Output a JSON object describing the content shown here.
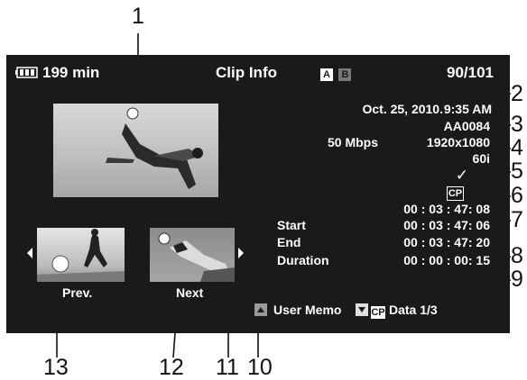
{
  "header": {
    "battery_time": "199 min",
    "title": "Clip Info",
    "slot_a": "A",
    "slot_b": "B",
    "clip_counter": "90/101"
  },
  "info": {
    "date": "Oct. 25, 2010.",
    "time": "9:35 AM",
    "clip_name": "AA0084",
    "bitrate": "50 Mbps",
    "resolution": "1920x1080",
    "frame_rate": "60i",
    "check_mark": "✓",
    "cp_badge": "CP",
    "timecode_top": "00 : 03 : 47: 08",
    "start_label": "Start",
    "start_value": "00 : 03 : 47: 06",
    "end_label": "End",
    "end_value": "00 : 03 : 47: 20",
    "duration_label": "Duration",
    "duration_value": "00 : 00 : 00: 15"
  },
  "nav": {
    "prev_label": "Prev.",
    "next_label": "Next"
  },
  "footer": {
    "user_memo_label": "User Memo",
    "cp_label": "CP",
    "data_label": "Data 1/3"
  },
  "callouts": {
    "n1": "1",
    "n2": "2",
    "n3": "3",
    "n4": "4",
    "n5": "5",
    "n6": "6",
    "n7": "7",
    "n8": "8",
    "n9": "9",
    "n10": "10",
    "n11": "11",
    "n12": "12",
    "n13": "13"
  },
  "colors": {
    "screen_bg": "#1a1a1a",
    "text": "#ffffff",
    "callout_line": "#111111"
  }
}
